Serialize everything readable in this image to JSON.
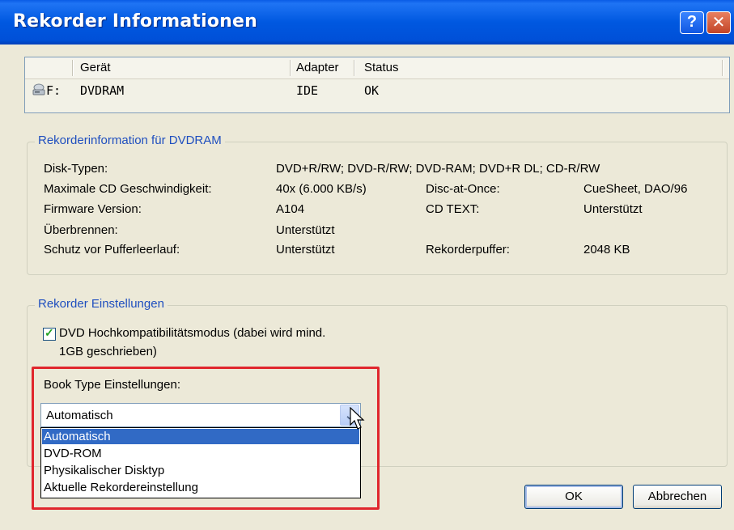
{
  "window": {
    "title": "Rekorder Informationen",
    "help_label": "?",
    "close_label": "✕"
  },
  "device_list": {
    "columns": [
      "Gerät",
      "Adapter",
      "Status"
    ],
    "rows": [
      {
        "drive": "F:",
        "name": "DVDRAM",
        "adapter": "IDE",
        "status": "OK"
      }
    ]
  },
  "recorder_info": {
    "title": "Rekorderinformation für DVDRAM",
    "disk_types_label": "Disk-Typen:",
    "disk_types_value": "DVD+R/RW; DVD-R/RW; DVD-RAM; DVD+R DL; CD-R/RW",
    "max_cd_speed_label": "Maximale CD Geschwindigkeit:",
    "max_cd_speed_value": "40x (6.000 KB/s)",
    "dao_label": "Disc-at-Once:",
    "dao_value": "CueSheet, DAO/96",
    "firmware_label": "Firmware Version:",
    "firmware_value": "A104",
    "cdtext_label": "CD TEXT:",
    "cdtext_value": "Unterstützt",
    "overburn_label": "Überbrennen:",
    "overburn_value": "Unterstützt",
    "buffer_protect_label": "Schutz vor Pufferleerlauf:",
    "buffer_protect_value": "Unterstützt",
    "buffer_label": "Rekorderpuffer:",
    "buffer_value": "2048 KB"
  },
  "recorder_settings": {
    "title": "Rekorder Einstellungen",
    "compat_checkbox_line1": "DVD Hochkompatibilitätsmodus (dabei wird mind.",
    "compat_checkbox_line2": "1GB geschrieben)",
    "compat_checked": true,
    "booktype_label": "Book Type Einstellungen:",
    "booktype_selected": "Automatisch",
    "booktype_options": [
      "Automatisch",
      "DVD-ROM",
      "Physikalischer Disktyp",
      "Aktuelle Rekordereinstellung"
    ]
  },
  "buttons": {
    "ok": "OK",
    "cancel": "Abbrechen"
  },
  "colors": {
    "titlebar": "#0058e0",
    "group_title": "#1f4fbf",
    "selection": "#316ac5",
    "highlight_box": "#e0262d"
  }
}
